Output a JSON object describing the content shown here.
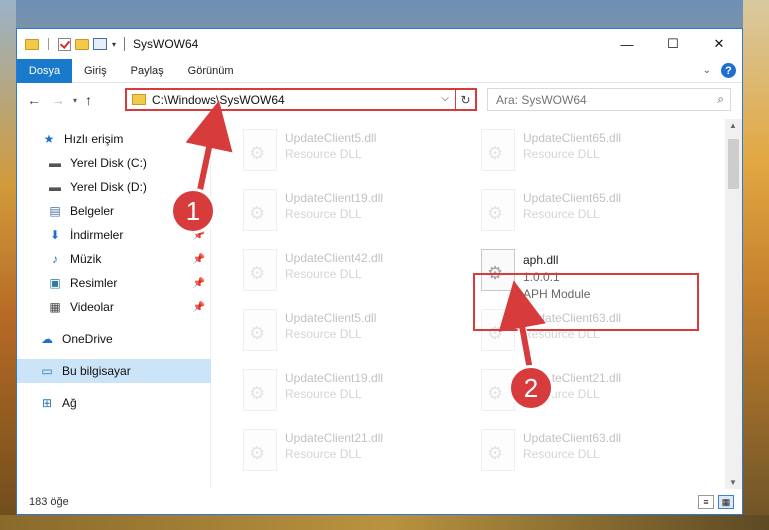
{
  "window": {
    "title": "SysWOW64",
    "minimize": "—",
    "maximize": "☐",
    "close": "✕"
  },
  "ribbon": {
    "tabs": [
      "Dosya",
      "Giriş",
      "Paylaş",
      "Görünüm"
    ]
  },
  "nav": {
    "back": "←",
    "forward": "→",
    "recent": "▾",
    "up": "↑",
    "address": "C:\\Windows\\SysWOW64",
    "search_placeholder": "Ara: SysWOW64"
  },
  "sidebar": {
    "items": [
      {
        "label": "Hızlı erişim",
        "icon": "star-icon"
      },
      {
        "label": "Yerel Disk (C:)",
        "icon": "drive-icon"
      },
      {
        "label": "Yerel Disk (D:)",
        "icon": "drive-icon"
      },
      {
        "label": "Belgeler",
        "icon": "documents-icon"
      },
      {
        "label": "İndirmeler",
        "icon": "download-icon"
      },
      {
        "label": "Müzik",
        "icon": "music-icon"
      },
      {
        "label": "Resimler",
        "icon": "pictures-icon"
      },
      {
        "label": "Videolar",
        "icon": "videos-icon"
      },
      {
        "label": "OneDrive",
        "icon": "cloud-icon"
      },
      {
        "label": "Bu bilgisayar",
        "icon": "computer-icon"
      },
      {
        "label": "Ağ",
        "icon": "network-icon"
      }
    ]
  },
  "files": [
    {
      "name": "UpdateClient5.dll",
      "sub1": "Resource DLL"
    },
    {
      "name": "UpdateClient65.dll",
      "sub1": "Resource DLL"
    },
    {
      "name": "UpdateClient19.dll",
      "sub1": "Resource DLL"
    },
    {
      "name": "UpdateClient65.dll",
      "sub1": "Resource DLL"
    },
    {
      "name": "UpdateClient42.dll",
      "sub1": "Resource DLL"
    },
    {
      "name": "aph.dll",
      "sub1": "1.0.0.1",
      "sub2": "APH Module"
    },
    {
      "name": "UpdateClient5.dll",
      "sub1": "Resource DLL"
    },
    {
      "name": "UpdateClient63.dll",
      "sub1": "Resource DLL"
    },
    {
      "name": "UpdateClient19.dll",
      "sub1": "Resource DLL"
    },
    {
      "name": "UpdateClient21.dll",
      "sub1": "Resource DLL"
    },
    {
      "name": "UpdateClient21.dll",
      "sub1": "Resource DLL"
    },
    {
      "name": "UpdateClient63.dll",
      "sub1": "Resource DLL"
    }
  ],
  "status": {
    "count": "183 öğe"
  },
  "annotations": {
    "badge1": "1",
    "badge2": "2"
  },
  "colors": {
    "accent": "#1979ca",
    "highlight": "#d83b3b",
    "selected": "#cce4f7"
  }
}
